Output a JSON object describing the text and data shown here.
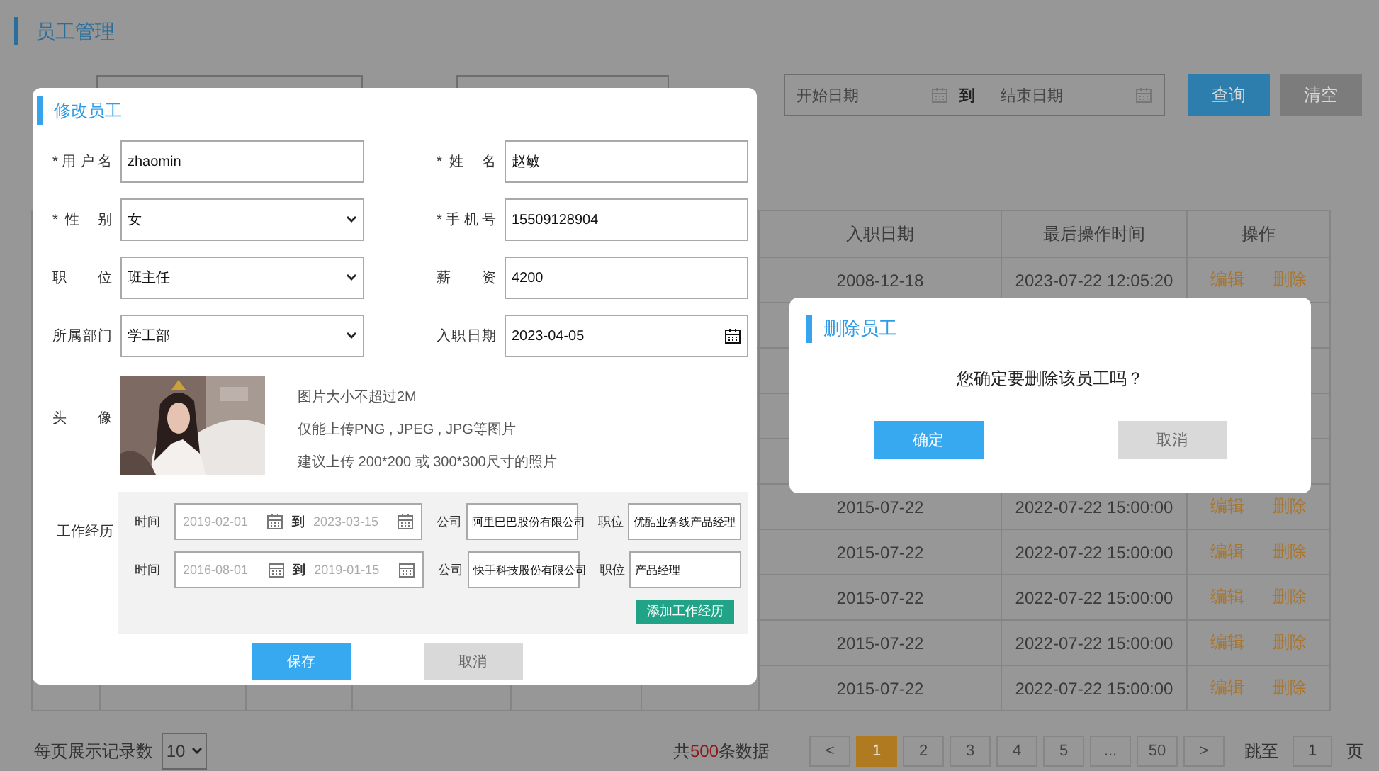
{
  "page_title": "员工管理",
  "filters": {
    "start_placeholder": "开始日期",
    "separator": "到",
    "end_placeholder": "结束日期",
    "buttons": [
      {
        "label": "查询",
        "kind": "primary"
      },
      {
        "label": "清空",
        "kind": "secondary"
      }
    ]
  },
  "table": {
    "columns": [
      "入职日期",
      "最后操作时间",
      "操作"
    ],
    "rows": [
      {
        "date": "2008-12-18",
        "time": "2023-07-22 12:05:20",
        "actions": [
          "编辑",
          "删除"
        ]
      },
      {},
      {},
      {},
      {},
      {
        "date": "2015-07-22",
        "time": "2022-07-22 15:00:00",
        "actions": [
          "编辑",
          "删除"
        ]
      },
      {
        "date": "2015-07-22",
        "time": "2022-07-22 15:00:00",
        "actions": [
          "编辑",
          "删除"
        ]
      },
      {
        "date": "2015-07-22",
        "time": "2022-07-22 15:00:00",
        "actions": [
          "编辑",
          "删除"
        ]
      },
      {
        "date": "2015-07-22",
        "time": "2022-07-22 15:00:00",
        "actions": [
          "编辑",
          "删除"
        ]
      },
      {
        "date": "2015-07-22",
        "time": "2022-07-22 15:00:00",
        "actions": [
          "编辑",
          "删除"
        ]
      }
    ]
  },
  "footer": {
    "page_size_label": "每页展示记录数",
    "page_size": "10",
    "total_prefix": "共",
    "total_count": "500",
    "total_suffix": "条数据",
    "pages": [
      {
        "label": "<",
        "selected": false
      },
      {
        "label": "1",
        "selected": true
      },
      {
        "label": "2",
        "selected": false
      },
      {
        "label": "3",
        "selected": false
      },
      {
        "label": "4",
        "selected": false
      },
      {
        "label": "5",
        "selected": false
      },
      {
        "label": "...",
        "selected": false
      },
      {
        "label": "50",
        "selected": false
      },
      {
        "label": ">",
        "selected": false
      }
    ],
    "jump_label": "跳至",
    "jump_value": "1",
    "jump_suffix": "页"
  },
  "edit_dialog": {
    "title": "修改员工",
    "fields": [
      {
        "label": "*用户名",
        "kind": "text",
        "value": "zhaomin"
      },
      {
        "label": "*姓 名",
        "kind": "text",
        "value": "赵敏"
      },
      {
        "label": "*性 别",
        "kind": "select",
        "value": "女"
      },
      {
        "label": "*手机号",
        "kind": "text",
        "value": "15509128904"
      },
      {
        "label": "职 位",
        "kind": "select",
        "value": "班主任"
      },
      {
        "label": "薪 资",
        "kind": "text",
        "value": "4200"
      },
      {
        "label": "所属部门",
        "kind": "select",
        "value": "学工部"
      },
      {
        "label": "入职日期",
        "kind": "date",
        "value": "2023-04-05"
      }
    ],
    "avatar": {
      "label": "头 像",
      "hints": [
        "图片大小不超过2M",
        "仅能上传PNG , JPEG , JPG等图片",
        "建议上传 200*200 或 300*300尺寸的照片"
      ]
    },
    "experience": {
      "label": "工作经历",
      "entries": [
        {
          "time_label": "时间",
          "start": "2019-02-01",
          "separator": "到",
          "end": "2023-03-15",
          "company_label": "公司",
          "company": "阿里巴巴股份有限公司",
          "position_label": "职位",
          "position": "优酷业务线产品经理"
        },
        {
          "time_label": "时间",
          "start": "2016-08-01",
          "separator": "到",
          "end": "2019-01-15",
          "company_label": "公司",
          "company": "快手科技股份有限公司",
          "position_label": "职位",
          "position": "产品经理"
        }
      ],
      "add_button": "添加工作经历"
    },
    "buttons": [
      {
        "label": "保存",
        "kind": "primary"
      },
      {
        "label": "取消",
        "kind": "secondary"
      }
    ]
  },
  "delete_dialog": {
    "title": "删除员工",
    "message": "您确定要删除该员工吗？",
    "buttons": [
      {
        "label": "确定",
        "kind": "primary"
      },
      {
        "label": "取消",
        "kind": "secondary"
      }
    ]
  }
}
